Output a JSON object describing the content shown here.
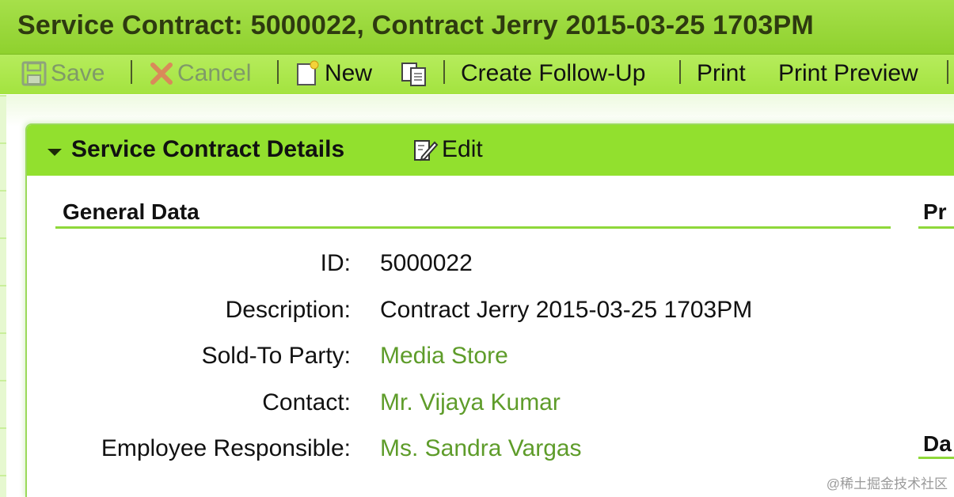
{
  "title_bar": {
    "title": "Service Contract: 5000022, Contract Jerry 2015-03-25 1703PM"
  },
  "toolbar": {
    "save_label": "Save",
    "save_state": "disabled",
    "cancel_label": "Cancel",
    "cancel_state": "disabled",
    "new_label": "New",
    "copy_icon": "copy-icon",
    "follow_up_label": "Create Follow-Up",
    "print_label": "Print",
    "print_preview_label": "Print Preview"
  },
  "panel": {
    "title": "Service Contract Details",
    "edit_label": "Edit"
  },
  "general_data": {
    "title": "General Data",
    "fields": [
      {
        "label": "ID:",
        "value": "5000022",
        "link": false
      },
      {
        "label": "Description:",
        "value": "Contract Jerry 2015-03-25 1703PM",
        "link": false
      },
      {
        "label": "Sold-To Party:",
        "value": "Media Store",
        "link": true
      },
      {
        "label": "Contact:",
        "value": "Mr. Vijaya Kumar",
        "link": true
      },
      {
        "label": "Employee Responsible:",
        "value": "Ms. Sandra Vargas",
        "link": true
      }
    ]
  },
  "side_sections": {
    "top_truncated": "Pr",
    "bottom_truncated": "Da"
  },
  "watermark": "@稀土掘金技术社区",
  "colors": {
    "title_bar": "#9ad93c",
    "toolbar": "#aee64e",
    "panel_header": "#92e02e",
    "section_line": "#8fd83a",
    "link": "#5e9c2a",
    "disabled": "#7f9a68"
  }
}
